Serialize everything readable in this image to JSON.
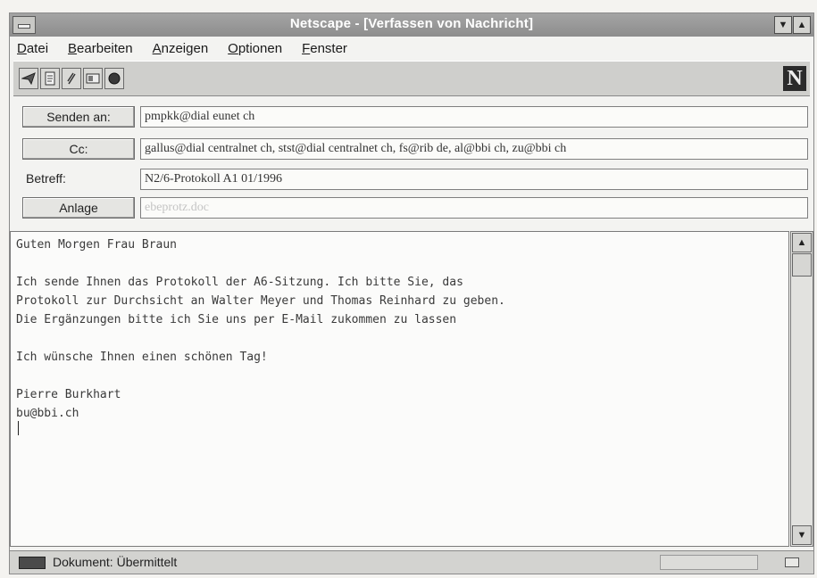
{
  "window": {
    "title": "Netscape - [Verfassen von Nachricht]",
    "min_glyph": "▼",
    "max_glyph": "▲"
  },
  "menu": [
    {
      "label": "Datei",
      "first": "D",
      "rest": "atei"
    },
    {
      "label": "Bearbeiten",
      "first": "B",
      "rest": "earbeiten"
    },
    {
      "label": "Anzeigen",
      "first": "A",
      "rest": "nzeigen"
    },
    {
      "label": "Optionen",
      "first": "O",
      "rest": "ptionen"
    },
    {
      "label": "Fenster",
      "first": "F",
      "rest": "enster"
    }
  ],
  "toolbar": {
    "buttons": [
      "send-icon",
      "quote-icon",
      "attach-icon",
      "address-book-icon",
      "stop-icon"
    ],
    "logo": "N"
  },
  "header": {
    "to_button": "Senden an:",
    "to_value": "pmpkk@dial eunet ch",
    "cc_button": "Cc:",
    "cc_value": "gallus@dial centralnet ch, stst@dial centralnet ch, fs@rib de, al@bbi ch, zu@bbi ch",
    "subject_label": "Betreff:",
    "subject_value": "N2/6-Protokoll A1 01/1996",
    "attach_button": "Anlage",
    "attach_value": "ebeprotz.doc"
  },
  "body": {
    "text": "Guten Morgen Frau Braun\n\nIch sende Ihnen das Protokoll der A6-Sitzung. Ich bitte Sie, das\nProtokoll zur Durchsicht an Walter Meyer und Thomas Reinhard zu geben.\nDie Ergänzungen bitte ich Sie uns per E-Mail zukommen zu lassen\n\nIch wünsche Ihnen einen schönen Tag!\n\nPierre Burkhart\nbu@bbi.ch"
  },
  "scrollbar": {
    "up": "▲",
    "down": "▼"
  },
  "status": {
    "text": "Dokument: Übermittelt"
  }
}
